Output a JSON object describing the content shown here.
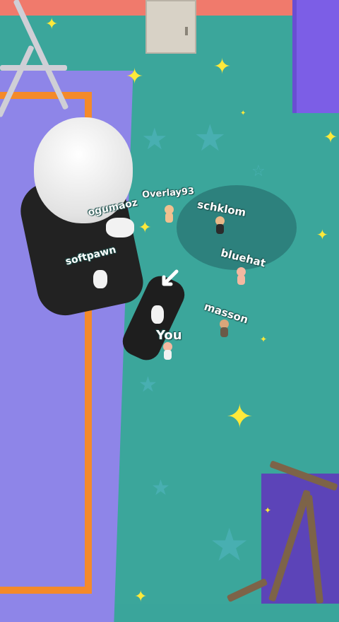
{
  "players": [
    {
      "id": "overlay93",
      "name": "Overlay93",
      "is_self": false
    },
    {
      "id": "ogumaoz",
      "name": "ogumaoz",
      "is_self": false
    },
    {
      "id": "schklom",
      "name": "schklom",
      "is_self": false
    },
    {
      "id": "softpawn",
      "name": "softpawn",
      "is_self": false
    },
    {
      "id": "bluehat",
      "name": "bluehat",
      "is_self": false
    },
    {
      "id": "masson",
      "name": "masson",
      "is_self": false
    },
    {
      "id": "you",
      "name": "You",
      "is_self": true
    }
  ],
  "icons": {
    "direction_arrow": "pointer-arrow-icon",
    "star": "star-icon"
  },
  "colors": {
    "floor": "#3ba69b",
    "rug": "#8e85e8",
    "rug_border": "#f48a2a",
    "wall": "#f07a6c",
    "purple_block": "#7c5ee6",
    "star": "#ffe93a",
    "giant_suit": "#222222",
    "giant_head": "#f0f0f0"
  }
}
